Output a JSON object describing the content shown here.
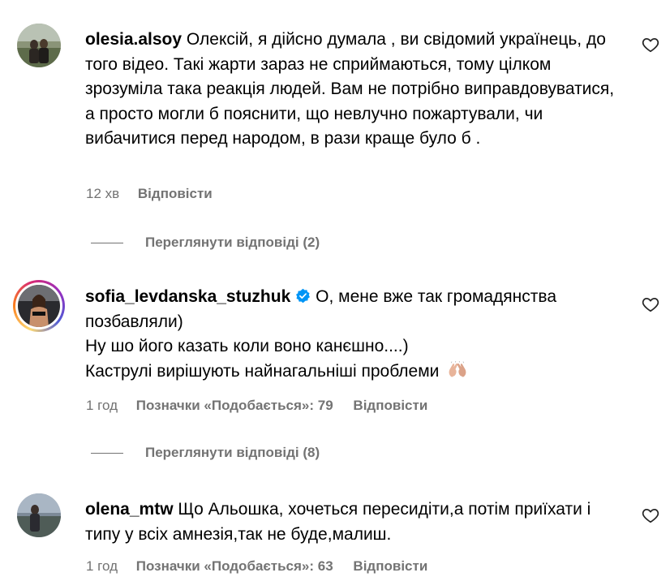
{
  "comments": [
    {
      "username": "olesia.alsoy",
      "text": "Олексій, я дійсно думала , ви свідомий українець, до того відео. Такі жарти зараз не сприймаються, тому цілком зрозуміла така реакція людей. Вам не потрібно виправдовуватися, а просто могли б пояснити, що невлучно пожартували, чи вибачитися перед народом, в рази краще було б .",
      "time": "12 хв",
      "reply_label": "Відповісти",
      "view_replies": "Переглянути відповіді (2)"
    },
    {
      "username": "sofia_levdanska_stuzhuk",
      "verified": true,
      "text": "О, мене вже так громадянства позбавляли)",
      "text2": "Ну шо його казать коли воно канєшно....)",
      "text3": "Каструлі вирішують найнагальніші проблеми",
      "emoji": "clapping-hands-emoji",
      "time": "1 год",
      "likes_label": "Позначки «Подобається»: 79",
      "reply_label": "Відповісти",
      "view_replies": "Переглянути відповіді (8)"
    },
    {
      "username": "olena_mtw",
      "text": "Що Альошка, хочеться пересидіти,а потім приїхати і типу у всіх амнезія,так не буде,малиш.",
      "time": "1 год",
      "likes_label": "Позначки «Подобається»: 63",
      "reply_label": "Відповісти"
    }
  ],
  "colors": {
    "text": "#000000",
    "secondary": "#737373",
    "verified_badge": "#0095f6"
  }
}
